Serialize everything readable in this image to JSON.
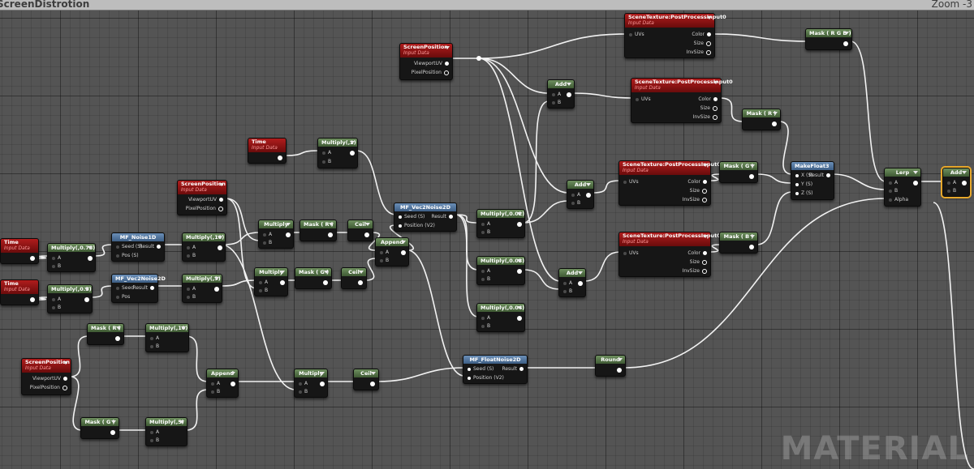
{
  "editor": {
    "title": "ScreenDistrotion",
    "zoom": "Zoom -3",
    "watermark": "MATERIAL"
  },
  "labels": {
    "input_data": "Input Data",
    "a": "A",
    "b": "B",
    "uvs": "UVs",
    "color": "Color",
    "size": "Size",
    "invsize": "InvSize",
    "viewport_uv": "ViewportUV",
    "pixel_position": "PixelPosition",
    "result": "Result",
    "seed_s": "Seed (S)",
    "pos_s": "Pos (S)",
    "seed": "Seed",
    "pos": "Pos",
    "position_v2": "Position (V2)",
    "result_s": "Result",
    "x_s": "X (S)",
    "y_s": "Y (S)",
    "z_s": "Z (S)",
    "alpha": "Alpha"
  },
  "nodes": {
    "time1": "Time",
    "time2": "Time",
    "time3": "Time",
    "screenpos1": "ScreenPosition",
    "screenpos2": "ScreenPosition",
    "screenpos3": "ScreenPosition",
    "mul_075": "Multiply(,0.75)",
    "mul_05": "Multiply(,0.5)",
    "noise1d": "MF_Noise1D",
    "vec2noise2d": "MF_Vec2Noise2D",
    "mul_10_a": "Multiply(,10)",
    "mul_5_a": "Multiply(,5)",
    "mul_a": "Multiply",
    "mul_b": "Multiply",
    "mask_r_a": "Mask ( R )",
    "mask_g_a": "Mask ( G )",
    "ceil_a": "Ceil",
    "ceil_b": "Ceil",
    "append_a": "Append",
    "mul_2": "Multiply(,2)",
    "vec2noise": "MF_Vec2Noise2D",
    "mul_002": "Multiply(,0.02)",
    "mul_003": "Multiply(,0.03)",
    "mul_004": "Multiply(,0.04)",
    "add_1": "Add",
    "add_2": "Add",
    "add_3": "Add",
    "add_4": "Add",
    "st1": "SceneTexture:PostProcessInput0",
    "st2": "SceneTexture:PostProcessInput0",
    "st3": "SceneTexture:PostProcessInput0",
    "st4": "SceneTexture:PostProcessInput0",
    "mask_rgb": "Mask ( R G B )",
    "mask_r_b": "Mask ( R )",
    "mask_g_b": "Mask ( G )",
    "mask_b": "Mask ( B )",
    "makefloat3": "MakeFloat3",
    "lerp": "Lerp",
    "mask_r_c": "Mask ( R )",
    "mask_g_c": "Mask ( G )",
    "mul_10_b": "Multiply(,10)",
    "mul_5_b": "Multiply(,5)",
    "append_b": "Append",
    "mul_c": "Multiply",
    "ceil_c": "Ceil",
    "floatnoise2d": "MF_FloatNoise2D",
    "round": "Round"
  }
}
